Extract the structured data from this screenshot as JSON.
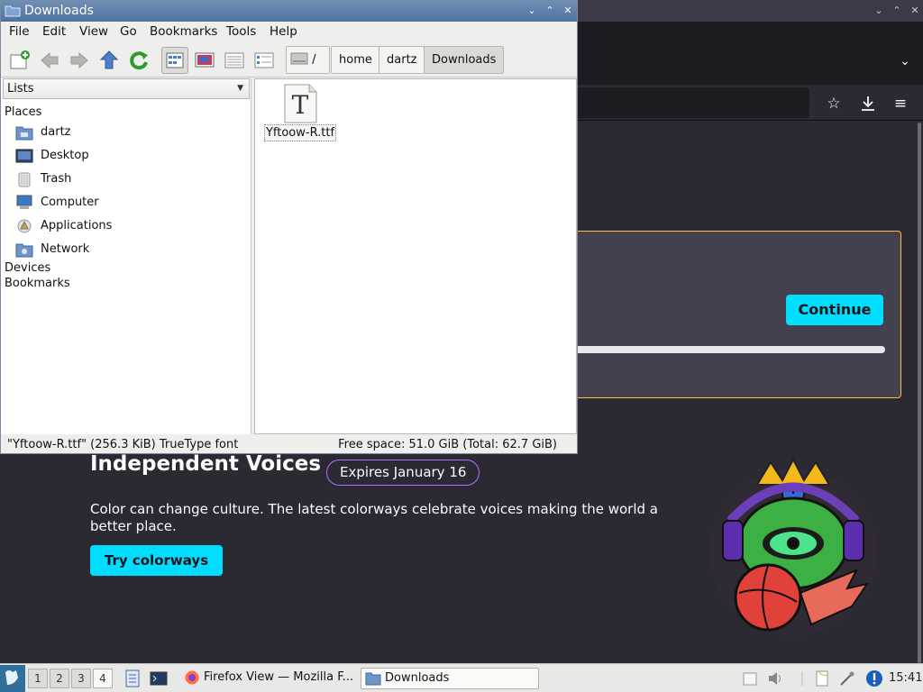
{
  "firefox": {
    "card_button": "Continue",
    "promo": {
      "title": "Independent Voices",
      "badge": "Expires January 16",
      "description": "Color can change culture. The latest colorways celebrate voices making the world a better place.",
      "button": "Try colorways"
    },
    "accent_color": "#00ddff"
  },
  "file_manager": {
    "title": "Downloads",
    "menu": [
      "File",
      "Edit",
      "View",
      "Go",
      "Bookmarks",
      "Tools",
      "Help"
    ],
    "breadcrumbs": [
      "/",
      "home",
      "dartz",
      "Downloads"
    ],
    "side_pane_mode": "Lists",
    "places_heading": "Places",
    "places": [
      {
        "label": "dartz",
        "icon": "home-folder-icon"
      },
      {
        "label": "Desktop",
        "icon": "desktop-icon"
      },
      {
        "label": "Trash",
        "icon": "trash-icon"
      },
      {
        "label": "Computer",
        "icon": "computer-icon"
      },
      {
        "label": "Applications",
        "icon": "applications-icon"
      },
      {
        "label": "Network",
        "icon": "network-icon"
      }
    ],
    "devices_heading": "Devices",
    "bookmarks_heading": "Bookmarks",
    "files": [
      {
        "name": "Yftoow-R.ttf",
        "icon": "font-file-icon"
      }
    ],
    "status_left": "\"Yftoow-R.ttf\" (256.3 KiB) TrueType font",
    "status_right": "Free space: 51.0 GiB (Total: 62.7 GiB)"
  },
  "taskbar": {
    "workspaces": [
      "1",
      "2",
      "3",
      "4"
    ],
    "active_workspace": "4",
    "tasks": [
      {
        "label": "Firefox View — Mozilla F...",
        "icon": "firefox-icon"
      },
      {
        "label": "Downloads",
        "icon": "folder-icon"
      }
    ],
    "clock": "15:41"
  }
}
